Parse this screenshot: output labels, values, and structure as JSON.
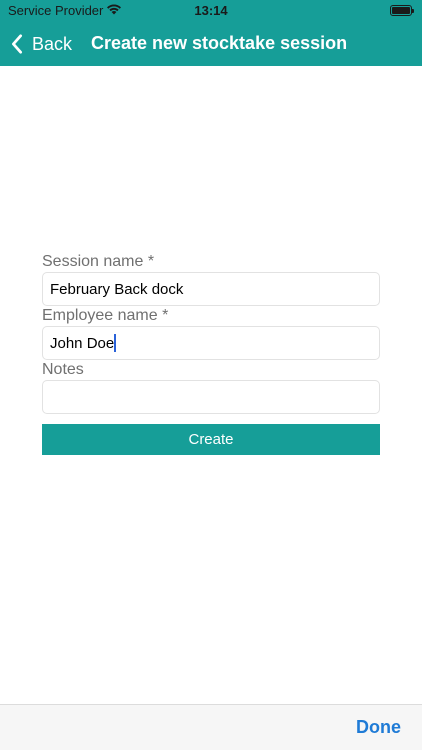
{
  "status_bar": {
    "carrier": "Service Provider",
    "time": "13:14",
    "battery_level": 1.0
  },
  "nav": {
    "back_label": "Back",
    "title": "Create new stocktake session"
  },
  "form": {
    "session_name": {
      "label": "Session name *",
      "value": "February Back dock"
    },
    "employee_name": {
      "label": "Employee name *",
      "value": "John Doe"
    },
    "notes": {
      "label": "Notes",
      "value": ""
    },
    "create_label": "Create"
  },
  "toolbar": {
    "done_label": "Done"
  },
  "colors": {
    "accent": "#169e98",
    "link": "#1f7bd6"
  }
}
